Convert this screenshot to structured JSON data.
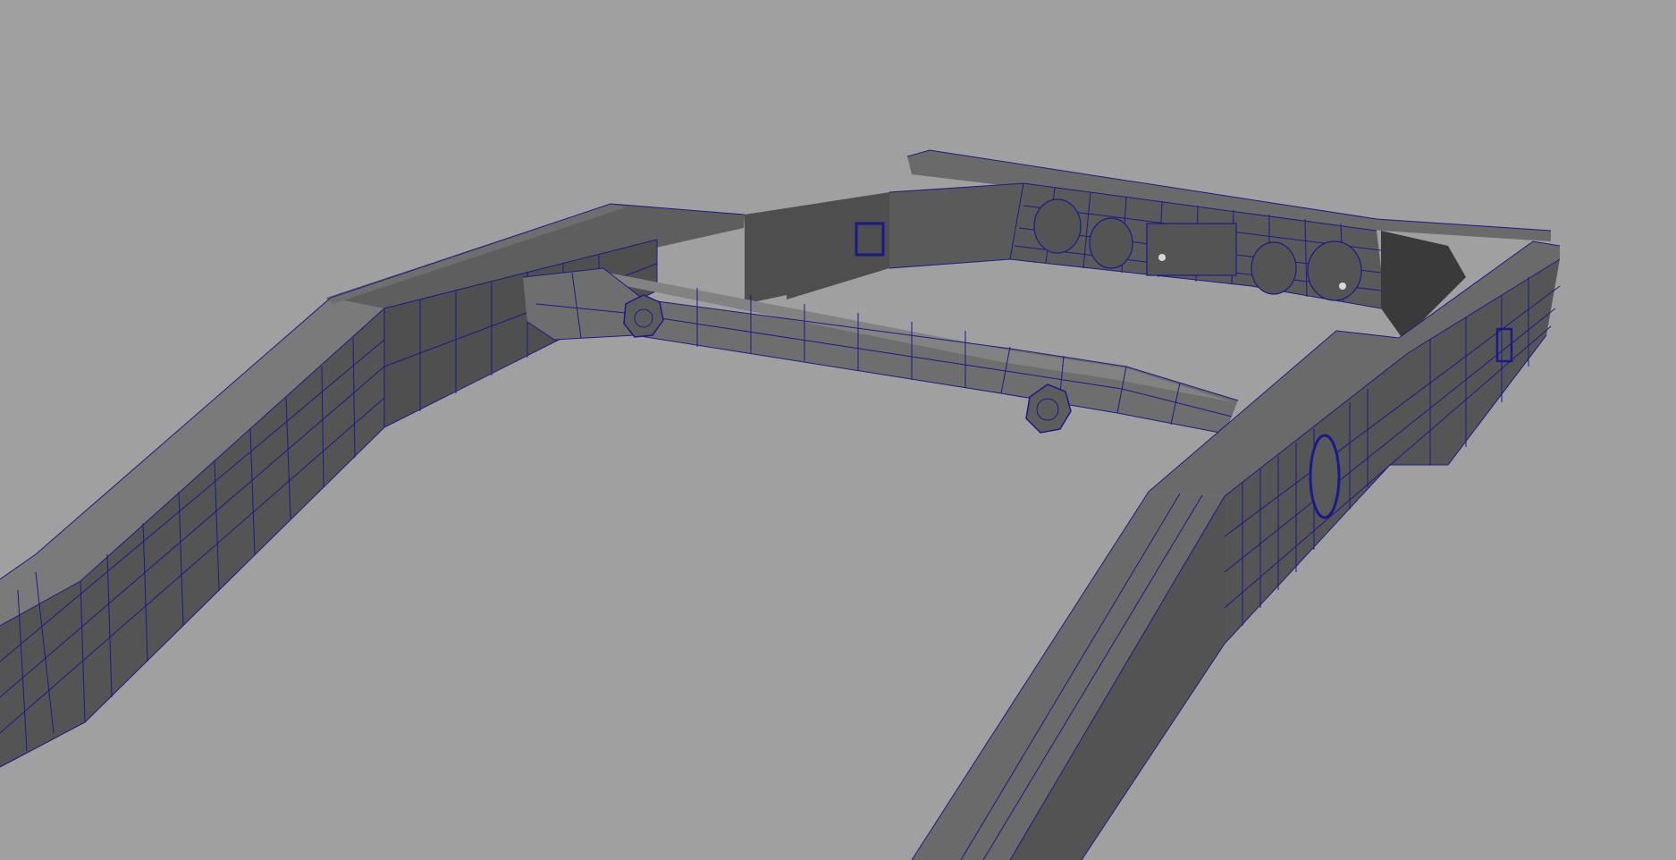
{
  "viewport": {
    "background": "#a0a0a0",
    "wire_color": "#1a1a8c",
    "shade_light": "#7a7a7a",
    "shade_mid": "#5e5e5e",
    "shade_dark": "#404040",
    "shade_top": "#6a6a6a"
  }
}
